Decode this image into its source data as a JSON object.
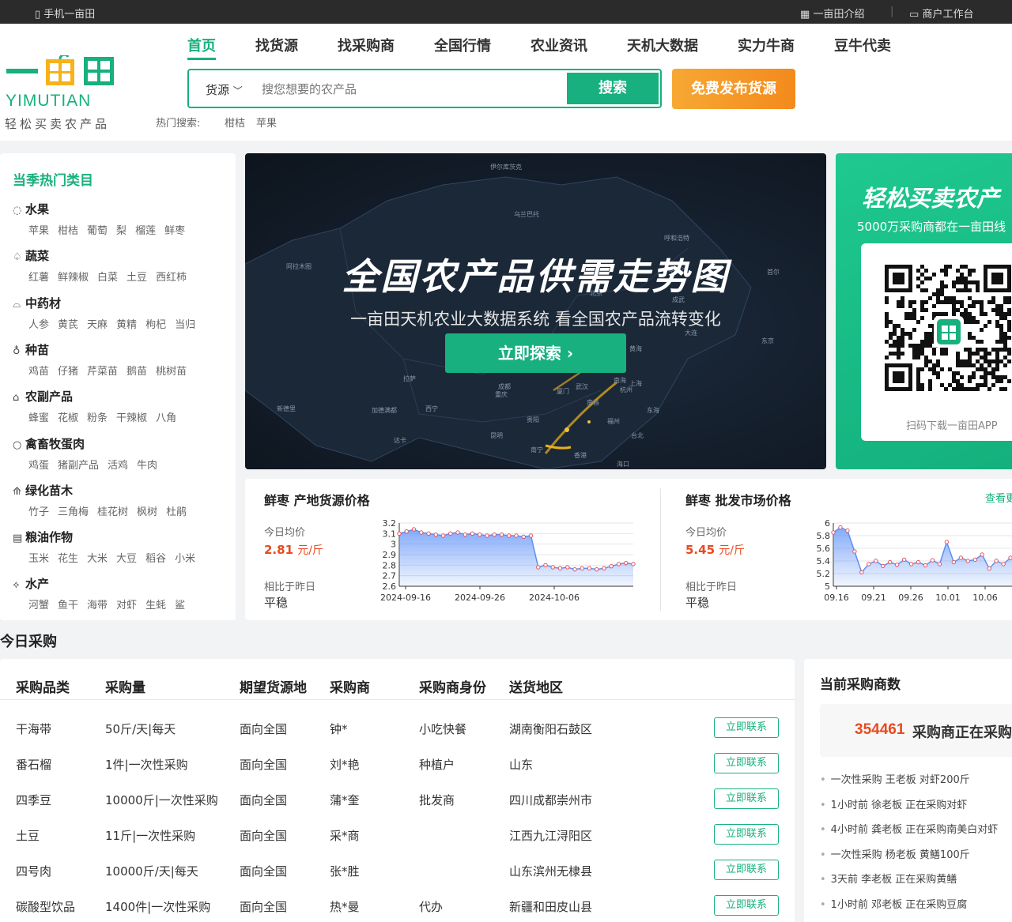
{
  "topbar": {
    "mobile": "手机一亩田",
    "intro": "一亩田介绍",
    "merchant": "商户工作台"
  },
  "logo": {
    "cn": "一亩田",
    "en": "YIMUTIAN",
    "slogan": "轻松买卖农产品"
  },
  "nav": [
    "首页",
    "找货源",
    "找采购商",
    "全国行情",
    "农业资讯",
    "天机大数据",
    "实力牛商",
    "豆牛代卖"
  ],
  "search": {
    "type": "货源",
    "placeholder": "搜您想要的农产品",
    "button": "搜索",
    "publish": "免费发布货源",
    "hot_label": "热门搜索:",
    "hot": [
      "柑桔",
      "苹果"
    ]
  },
  "categories": {
    "title": "当季热门类目",
    "groups": [
      {
        "name": "水果",
        "icon": "apple-icon",
        "items": [
          "苹果",
          "柑桔",
          "葡萄",
          "梨",
          "榴莲",
          "鲜枣"
        ]
      },
      {
        "name": "蔬菜",
        "icon": "vegetable-icon",
        "items": [
          "红薯",
          "鲜辣椒",
          "白菜",
          "土豆",
          "西红柿"
        ]
      },
      {
        "name": "中药材",
        "icon": "herb-icon",
        "items": [
          "人参",
          "黄芪",
          "天麻",
          "黄精",
          "枸杞",
          "当归"
        ]
      },
      {
        "name": "种苗",
        "icon": "seedling-icon",
        "items": [
          "鸡苗",
          "仔猪",
          "芹菜苗",
          "鹅苗",
          "桃树苗"
        ]
      },
      {
        "name": "农副产品",
        "icon": "product-icon",
        "items": [
          "蜂蜜",
          "花椒",
          "粉条",
          "干辣椒",
          "八角"
        ]
      },
      {
        "name": "禽畜牧蛋肉",
        "icon": "egg-icon",
        "items": [
          "鸡蛋",
          "猪副产品",
          "活鸡",
          "牛肉"
        ]
      },
      {
        "name": "绿化苗木",
        "icon": "tree-icon",
        "items": [
          "竹子",
          "三角梅",
          "桂花树",
          "枫树",
          "杜鹃"
        ]
      },
      {
        "name": "粮油作物",
        "icon": "grain-icon",
        "items": [
          "玉米",
          "花生",
          "大米",
          "大豆",
          "稻谷",
          "小米"
        ]
      },
      {
        "name": "水产",
        "icon": "fish-icon",
        "items": [
          "河蟹",
          "鱼干",
          "海带",
          "对虾",
          "生蚝",
          "鲨"
        ]
      }
    ]
  },
  "banner": {
    "title": "全国农产品供需走势图",
    "subtitle": "一亩田天机农业大数据系统  看全国农产品流转变化",
    "button": "立即探索",
    "map_labels": [
      "伊尔库茨克",
      "乌兰巴托",
      "呼和浩特",
      "哈尔滨",
      "北京",
      "成武",
      "大连",
      "首尔",
      "东京",
      "上海",
      "武汉",
      "杭州",
      "南昌",
      "福州",
      "台北",
      "厦门",
      "南宁",
      "香港",
      "海口",
      "成都",
      "重庆",
      "贵阳",
      "昆明",
      "西宁",
      "拉萨",
      "黄海",
      "东海",
      "南海",
      "阿拉木图",
      "新德里",
      "加德满都",
      "达卡"
    ]
  },
  "promo": {
    "title": "轻松买卖农产",
    "subtitle": "5000万采购商都在一亩田线",
    "scan": "扫码下载一亩田APP"
  },
  "prices": {
    "more": "查看更",
    "origin": {
      "title": "鲜枣 产地货源价格",
      "avg_label": "今日均价",
      "price": "2.81",
      "unit": "元/斤",
      "cmp_label": "相比于昨日",
      "cmp": "平稳"
    },
    "wholesale": {
      "title": "鲜枣 批发市场价格",
      "avg_label": "今日均价",
      "price": "5.45",
      "unit": "元/斤",
      "cmp_label": "相比于昨日",
      "cmp": "平稳"
    }
  },
  "chart_data": [
    {
      "type": "area",
      "title": "鲜枣 产地货源价格",
      "ylim": [
        2.6,
        3.2
      ],
      "yticks": [
        "3.2",
        "3.1",
        "3",
        "2.9",
        "2.8",
        "2.7",
        "2.6"
      ],
      "xticks": [
        "2024-09-16",
        "2024-09-26",
        "2024-10-06"
      ],
      "series": [
        {
          "values": [
            3.1,
            3.12,
            3.14,
            3.11,
            3.1,
            3.09,
            3.08,
            3.1,
            3.11,
            3.09,
            3.1,
            3.09,
            3.08,
            3.09,
            3.09,
            3.08,
            3.08,
            3.07,
            3.08,
            2.78,
            2.8,
            2.78,
            2.77,
            2.78,
            2.76,
            2.77,
            2.77,
            2.76,
            2.77,
            2.79,
            2.81,
            2.82,
            2.81
          ]
        }
      ]
    },
    {
      "type": "area",
      "title": "鲜枣 批发市场价格",
      "ylim": [
        5,
        6
      ],
      "yticks": [
        "6",
        "5.8",
        "5.6",
        "5.4",
        "5.2",
        "5"
      ],
      "xticks": [
        "09.16",
        "09.21",
        "09.26",
        "10.01",
        "10.06",
        "10"
      ],
      "series": [
        {
          "values": [
            5.85,
            5.93,
            5.88,
            5.55,
            5.22,
            5.35,
            5.4,
            5.32,
            5.38,
            5.34,
            5.42,
            5.35,
            5.38,
            5.33,
            5.41,
            5.35,
            5.7,
            5.38,
            5.45,
            5.4,
            5.42,
            5.5,
            5.28,
            5.4,
            5.35,
            5.45,
            5.4,
            5.39
          ]
        }
      ]
    }
  ],
  "purchases": {
    "section_title": "今日采购",
    "headers": [
      "采购品类",
      "采购量",
      "期望货源地",
      "采购商",
      "采购商身份",
      "送货地区"
    ],
    "contact_label": "立即联系",
    "rows": [
      [
        "干海带",
        "50斤/天|每天",
        "面向全国",
        "钟*",
        "小吃快餐",
        "湖南衡阳石鼓区"
      ],
      [
        "番石榴",
        "1件|一次性采购",
        "面向全国",
        "刘*艳",
        "种植户",
        "山东"
      ],
      [
        "四季豆",
        "10000斤|一次性采购",
        "面向全国",
        "蒲*奎",
        "批发商",
        "四川成都崇州市"
      ],
      [
        "土豆",
        "11斤|一次性采购",
        "面向全国",
        "采*商",
        "",
        "江西九江浔阳区"
      ],
      [
        "四号肉",
        "10000斤/天|每天",
        "面向全国",
        "张*胜",
        "",
        "山东滨州无棣县"
      ],
      [
        "碳酸型饮品",
        "1400件|一次性采购",
        "面向全国",
        "热*曼",
        "代办",
        "新疆和田皮山县"
      ]
    ]
  },
  "buyers": {
    "title": "当前采购商数",
    "count": "354461",
    "count_text": "采购商正在采购",
    "feed": [
      "一次性采购  王老板  对虾200斤",
      "1小时前  徐老板  正在采购对虾",
      "4小时前  龚老板  正在采购南美白对虾",
      "一次性采购  杨老板  黄鳝100斤",
      "3天前  李老板  正在采购黄鳝",
      "1小时前  邓老板  正在采购豆腐"
    ]
  },
  "colors": {
    "brand": "#17b07e",
    "accent_orange": "#f38a1c",
    "price_red": "#e84a1f",
    "chart_line": "#5b8ff9"
  }
}
